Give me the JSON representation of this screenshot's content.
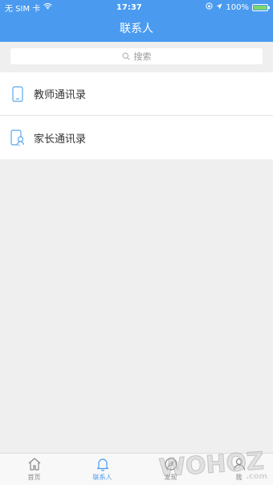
{
  "status_bar": {
    "carrier": "无 SIM 卡",
    "time": "17:37",
    "battery": "100%"
  },
  "header": {
    "title": "联系人"
  },
  "search": {
    "placeholder": "搜索"
  },
  "contacts": [
    {
      "label": "教师通讯录",
      "icon": "phone-icon"
    },
    {
      "label": "家长通讯录",
      "icon": "parent-phone-icon"
    }
  ],
  "tabbar": {
    "items": [
      {
        "label": "首页",
        "icon": "home-icon",
        "active": false
      },
      {
        "label": "联系人",
        "icon": "bell-icon",
        "active": true
      },
      {
        "label": "发现",
        "icon": "discover-icon",
        "active": false
      },
      {
        "label": "我",
        "icon": "person-icon",
        "active": false
      }
    ]
  },
  "watermark": {
    "text": "WOHOZ",
    "domain": ".com"
  },
  "colors": {
    "primary": "#4a9bf0",
    "background": "#efefef"
  }
}
